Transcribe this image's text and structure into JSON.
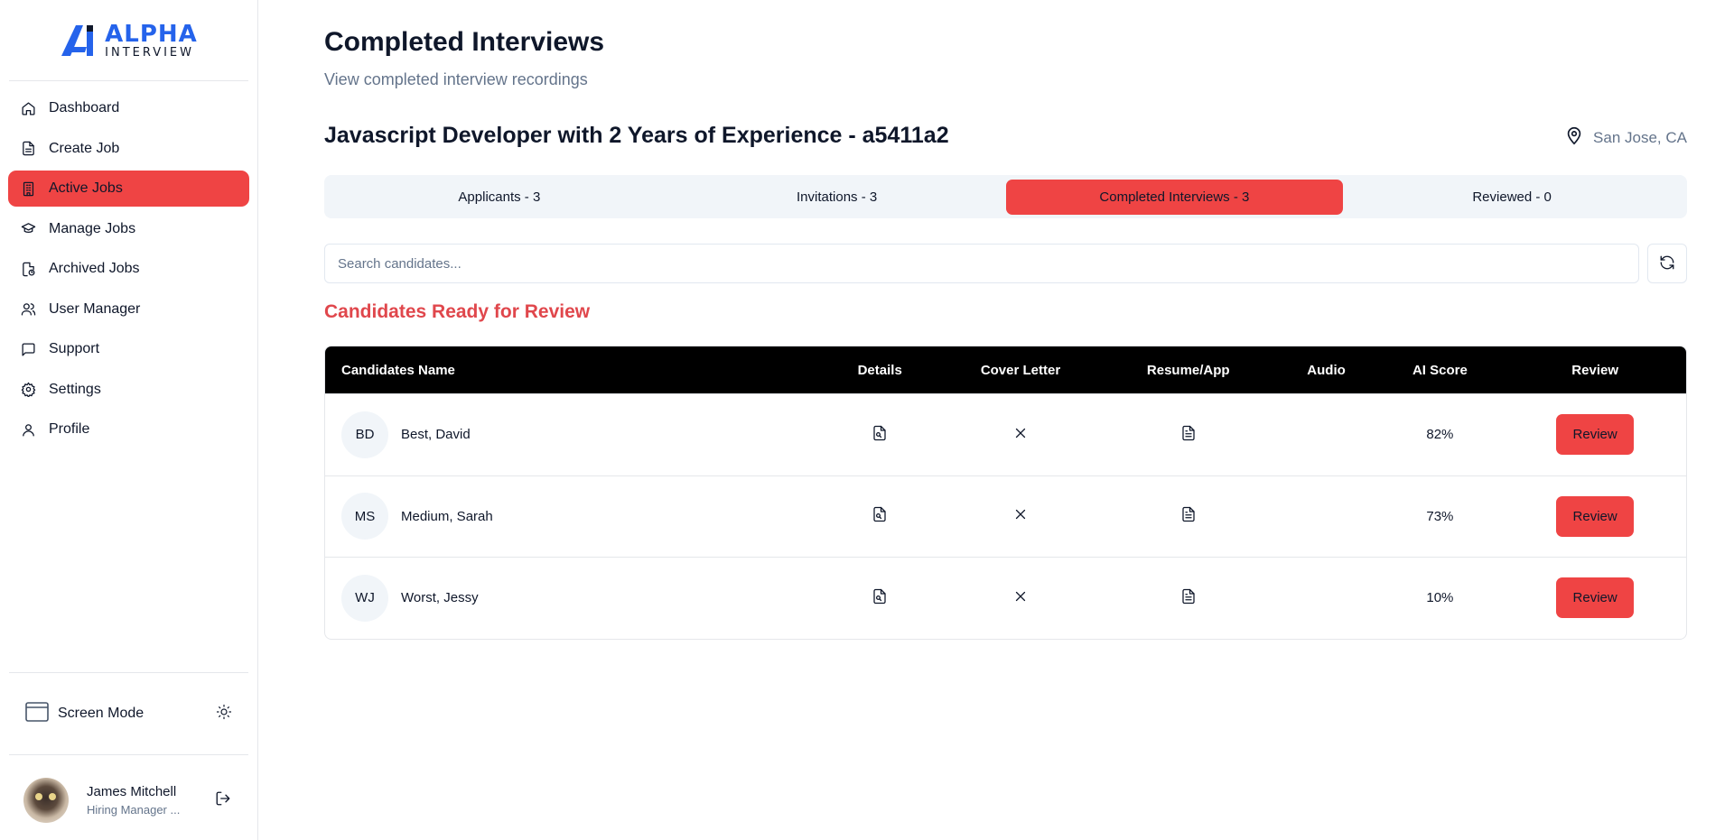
{
  "brand": {
    "name": "ALPHA",
    "tagline": "INTERVIEW",
    "accent": "#2563eb"
  },
  "sidebar": {
    "items": [
      {
        "label": "Dashboard",
        "icon": "home-icon"
      },
      {
        "label": "Create Job",
        "icon": "document-icon"
      },
      {
        "label": "Active Jobs",
        "icon": "building-icon",
        "active": true
      },
      {
        "label": "Manage Jobs",
        "icon": "graduation-cap-icon"
      },
      {
        "label": "Archived Jobs",
        "icon": "archive-icon"
      },
      {
        "label": "User Manager",
        "icon": "users-icon"
      },
      {
        "label": "Support",
        "icon": "message-icon"
      },
      {
        "label": "Settings",
        "icon": "gear-icon"
      },
      {
        "label": "Profile",
        "icon": "user-icon"
      }
    ],
    "screen_mode_label": "Screen Mode",
    "user": {
      "name": "James Mitchell",
      "role": "Hiring Manager ..."
    }
  },
  "main": {
    "title": "Completed Interviews",
    "subtitle": "View completed interview recordings",
    "job_title": "Javascript Developer with 2 Years of Experience - a5411a2",
    "location": "San Jose, CA",
    "tabs": [
      {
        "label": "Applicants - 3"
      },
      {
        "label": "Invitations - 3"
      },
      {
        "label": "Completed Interviews - 3",
        "active": true
      },
      {
        "label": "Reviewed - 0"
      }
    ],
    "search": {
      "placeholder": "Search candidates..."
    },
    "section_title": "Candidates Ready for Review",
    "table": {
      "headers": [
        "Candidates Name",
        "Details",
        "Cover Letter",
        "Resume/App",
        "Audio",
        "AI Score",
        "Review"
      ],
      "rows": [
        {
          "initials": "BD",
          "name": "Best, David",
          "score": "82%",
          "review": "Review"
        },
        {
          "initials": "MS",
          "name": "Medium, Sarah",
          "score": "73%",
          "review": "Review"
        },
        {
          "initials": "WJ",
          "name": "Worst, Jessy",
          "score": "10%",
          "review": "Review"
        }
      ]
    }
  },
  "colors": {
    "primary": "#ef4444",
    "section_title": "#e0474c",
    "table_header": "#000000"
  }
}
